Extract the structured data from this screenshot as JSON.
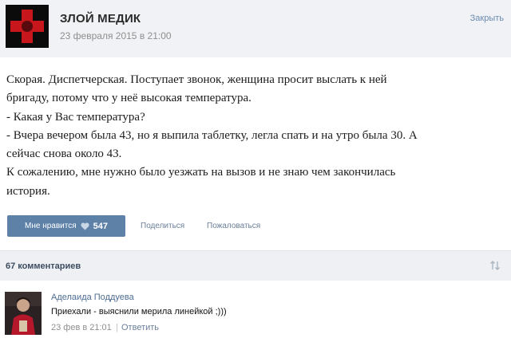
{
  "post": {
    "author": "ЗЛОЙ МЕДИК",
    "date": "23 февраля 2015 в 21:00",
    "close_label": "Закрыть",
    "text_lines": [
      "Скорая. Диспетчерская. Поступает звонок, женщина просит выслать к ней",
      "бригаду, потому что у неё высокая температура.",
      "- Какая у Вас температура?",
      "- Вчера вечером была 43, но я выпила таблетку, легла спать и на утро была 30. А",
      "сейчас снова около 43.",
      "К сожалению, мне нужно было уезжать на вызов и не знаю чем закончилась",
      "история."
    ]
  },
  "actions": {
    "like_label": "Мне нравится",
    "like_count": "547",
    "share_label": "Поделиться",
    "report_label": "Пожаловаться"
  },
  "comments": {
    "count_label": "67 комментариев"
  },
  "comment": {
    "author": "Аделаида Поддуева",
    "text": "Приехали - выяснили мерила линейкой ;)))",
    "date": "23 фев в 21:01",
    "separator": "|",
    "reply_label": "Ответить"
  },
  "colors": {
    "like_button": "#5e81a8",
    "link": "#6b7f99",
    "author_link": "#4e6c91",
    "header_bg": "#f0f2f5",
    "logo_red": "#c8161d"
  },
  "icons": {
    "avatar_main": "red-cross-logo",
    "like": "heart-icon",
    "sort": "sort-arrows-icon"
  }
}
